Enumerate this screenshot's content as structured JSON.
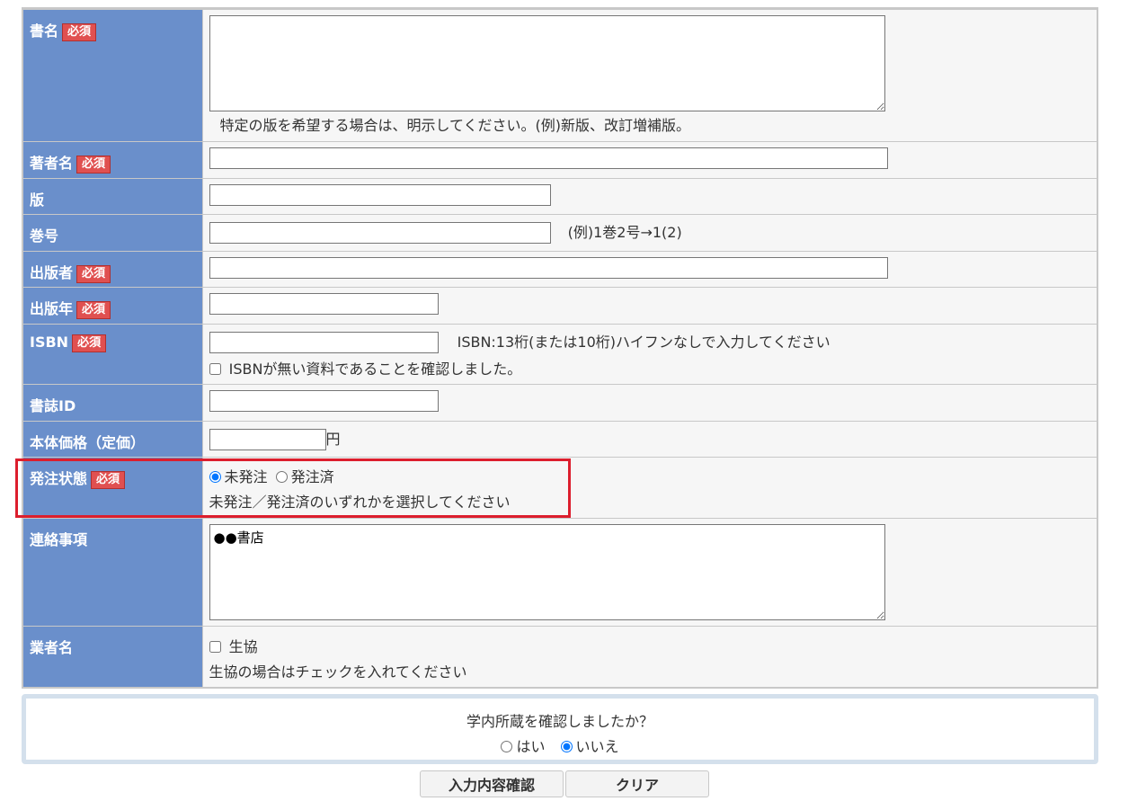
{
  "required_badge": "必須",
  "fields": {
    "title": {
      "label": "書名",
      "value": "",
      "note": "特定の版を希望する場合は、明示してください。(例)新版、改訂増補版。"
    },
    "author": {
      "label": "著者名",
      "value": ""
    },
    "edition": {
      "label": "版",
      "value": ""
    },
    "volume": {
      "label": "巻号",
      "value": "",
      "note": "(例)1巻2号→1(2)"
    },
    "publisher": {
      "label": "出版者",
      "value": ""
    },
    "pub_year": {
      "label": "出版年",
      "value": ""
    },
    "isbn": {
      "label": "ISBN",
      "value": "",
      "note": "ISBN:13桁(または10桁)ハイフンなしで入力してください",
      "checkbox_label": "ISBNが無い資料であることを確認しました。",
      "checkbox_checked": false
    },
    "bib_id": {
      "label": "書誌ID",
      "value": ""
    },
    "price": {
      "label": "本体価格（定価）",
      "value": "",
      "unit": "円"
    },
    "order_status": {
      "label": "発注状態",
      "options": [
        "未発注",
        "発注済"
      ],
      "selected": "未発注",
      "note": "未発注／発注済のいずれかを選択してください"
    },
    "contact": {
      "label": "連絡事項",
      "value": "●●書店"
    },
    "vendor": {
      "label": "業者名",
      "checkbox_label": "生協",
      "checkbox_checked": false,
      "note": "生協の場合はチェックを入れてください"
    }
  },
  "confirm": {
    "question": "学内所蔵を確認しましたか？",
    "yes": "はい",
    "no": "いいえ",
    "selected": "いいえ"
  },
  "buttons": {
    "confirm": "入力内容確認",
    "clear": "クリア"
  },
  "colors": {
    "label_bg": "#6a8fcb",
    "required_bg": "#e05050",
    "highlight": "#dc1e2d"
  }
}
